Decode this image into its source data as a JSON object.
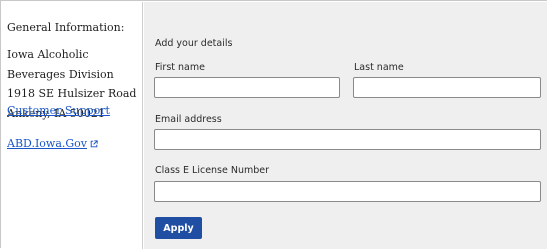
{
  "info": {
    "heading": "General Information:",
    "address": "Iowa Alcoholic Beverages Division 1918 SE Hulsizer Road Ankeny, IA 50021",
    "support_link": "Customer Support",
    "gov_link": "ABD.Iowa.Gov",
    "external_icon": "external-link-icon"
  },
  "form": {
    "title": "Add your details",
    "first_name_label": "First name",
    "first_name_value": "",
    "last_name_label": "Last name",
    "last_name_value": "",
    "email_label": "Email address",
    "email_value": "",
    "license_label": "Class E License Number",
    "license_value": "",
    "apply_label": "Apply"
  },
  "colors": {
    "link": "#1a56c7",
    "button": "#1f4ea3",
    "panel_bg": "#efefef"
  }
}
